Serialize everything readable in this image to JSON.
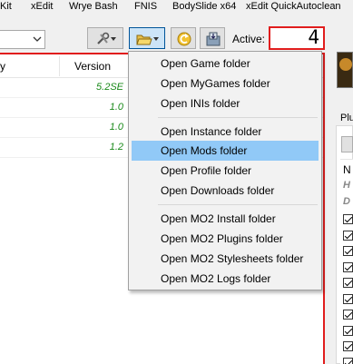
{
  "executables": [
    {
      "label": "Kit"
    },
    {
      "label": "xEdit"
    },
    {
      "label": "Wrye Bash"
    },
    {
      "label": "FNIS"
    },
    {
      "label": "BodySlide x64"
    },
    {
      "label": "xEdit QuickAutoclean"
    }
  ],
  "toolbar": {
    "active_label": "Active:",
    "active_count": "4",
    "folder_button_icon": "open-folder-icon",
    "tools_button_icon": "tools-icon",
    "restore_button_icon": "restore-arrow-icon",
    "backup_button_icon": "backup-disk-icon"
  },
  "modlist": {
    "columns": [
      "y",
      "Version"
    ],
    "rows": [
      {
        "version": "5.2SE"
      },
      {
        "version": "1.0"
      },
      {
        "version": "1.0"
      },
      {
        "version": "1.2"
      }
    ]
  },
  "right_panel": {
    "tab_label": "Plu",
    "list_header": "N",
    "ghost_rows": [
      "H",
      "D"
    ],
    "checked_count": 10
  },
  "folder_menu": {
    "groups": [
      [
        "Open Game folder",
        "Open MyGames folder",
        "Open INIs folder"
      ],
      [
        "Open Instance folder",
        "Open Mods folder",
        "Open Profile folder",
        "Open Downloads folder"
      ],
      [
        "Open MO2 Install folder",
        "Open MO2 Plugins folder",
        "Open MO2 Stylesheets folder",
        "Open MO2 Logs folder"
      ]
    ],
    "highlighted": "Open Mods folder"
  },
  "colors": {
    "accent_red": "#e11d1d",
    "highlight": "#91c9f7",
    "version_green": "#1b8a1b"
  }
}
